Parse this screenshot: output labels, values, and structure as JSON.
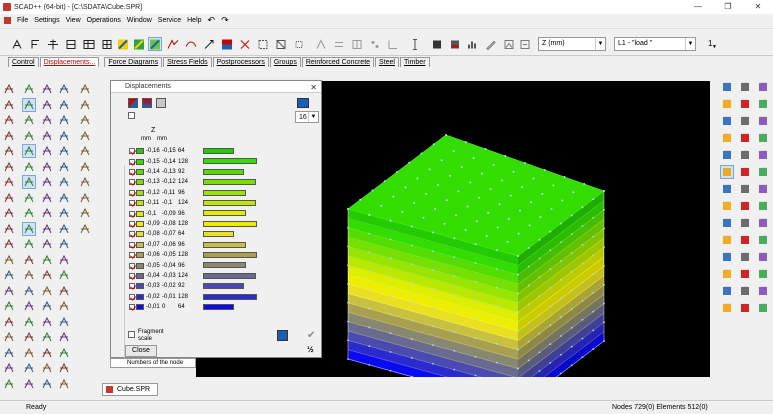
{
  "window": {
    "title": "SCAD++ (64-bit) - [C:\\SDATA\\Cube.SPR]",
    "controls": [
      "—",
      "❐",
      "✕"
    ]
  },
  "menu": {
    "items": [
      "File",
      "Settings",
      "View",
      "Operations",
      "Window",
      "Service",
      "Help"
    ]
  },
  "toolbar": {
    "combo_z": "Z (mm)",
    "combo_load": "L1 - \"load \"",
    "step_value": "1"
  },
  "tabs": [
    "Control",
    "Displacements",
    "Force Diagrams",
    "Stress Fields",
    "Postprocessors",
    "Groups",
    "Reinforced Concrete",
    "Steel",
    "Timber"
  ],
  "dialog": {
    "title": "Displacements",
    "count_value": "16",
    "header_label": "Z",
    "unit_from": "mm",
    "unit_to": "mm",
    "fragment_label": "Fragment scale",
    "close_label": "Close",
    "tree_item": "Numbers of the node"
  },
  "legend": [
    {
      "from": "-0,16",
      "to": "-0,15",
      "pct": "64",
      "color": "#22cc00"
    },
    {
      "from": "-0,15",
      "to": "-0,14",
      "pct": "128",
      "color": "#33dd00"
    },
    {
      "from": "-0,14",
      "to": "-0,13",
      "pct": "92",
      "color": "#55dd00"
    },
    {
      "from": "-0,13",
      "to": "-0,12",
      "pct": "124",
      "color": "#77e000"
    },
    {
      "from": "-0,12",
      "to": "-0,11",
      "pct": "96",
      "color": "#99e400"
    },
    {
      "from": "-0,11",
      "to": "-0,1",
      "pct": "124",
      "color": "#bbe800"
    },
    {
      "from": "-0,1",
      "to": "-0,09",
      "pct": "96",
      "color": "#ddee00"
    },
    {
      "from": "-0,09",
      "to": "-0,08",
      "pct": "128",
      "color": "#eeee00"
    },
    {
      "from": "-0,08",
      "to": "-0,07",
      "pct": "64",
      "color": "#e8e020"
    },
    {
      "from": "-0,07",
      "to": "-0,06",
      "pct": "96",
      "color": "#c8c040"
    },
    {
      "from": "-0,06",
      "to": "-0,05",
      "pct": "128",
      "color": "#a8a050"
    },
    {
      "from": "-0,05",
      "to": "-0,04",
      "pct": "96",
      "color": "#888870"
    },
    {
      "from": "-0,04",
      "to": "-0,03",
      "pct": "124",
      "color": "#6a6a90"
    },
    {
      "from": "-0,03",
      "to": "-0,02",
      "pct": "92",
      "color": "#4a4ab0"
    },
    {
      "from": "-0,02",
      "to": "-0,01",
      "pct": "128",
      "color": "#2a2ad0"
    },
    {
      "from": "-0,01",
      "to": "0",
      "pct": "64",
      "color": "#0a0af0"
    }
  ],
  "document_tab": "Cube.SPR",
  "status": {
    "left": "Ready",
    "right": "Nodes 729(0) Elements 512(0)"
  }
}
